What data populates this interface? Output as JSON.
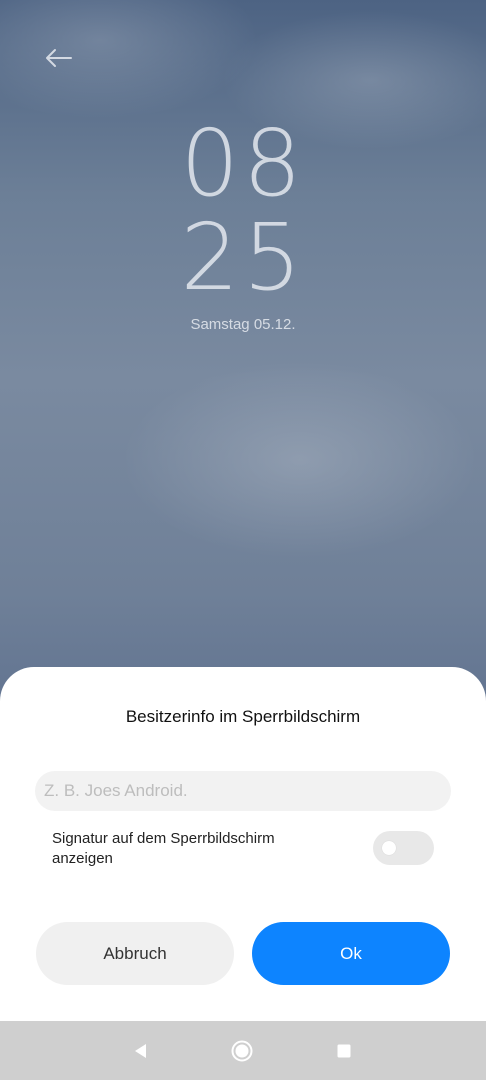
{
  "lockscreen": {
    "hours": "08",
    "minutes": "25",
    "date": "Samstag 05.12."
  },
  "dialog": {
    "title": "Besitzerinfo im Sperrbildschirm",
    "input_placeholder": "Z. B. Joes Android.",
    "input_value": "",
    "signature_label": "Signatur auf dem Sperrbildschirm anzeigen",
    "signature_enabled": false,
    "cancel_label": "Abbruch",
    "ok_label": "Ok"
  },
  "colors": {
    "accent": "#0d84ff",
    "toggle_off": "#e8e8e8",
    "navbar": "#cfcfcf"
  },
  "icons": {
    "back": "arrow-left-icon",
    "nav_back": "triangle-back-icon",
    "nav_home": "circle-home-icon",
    "nav_recent": "square-recents-icon"
  }
}
